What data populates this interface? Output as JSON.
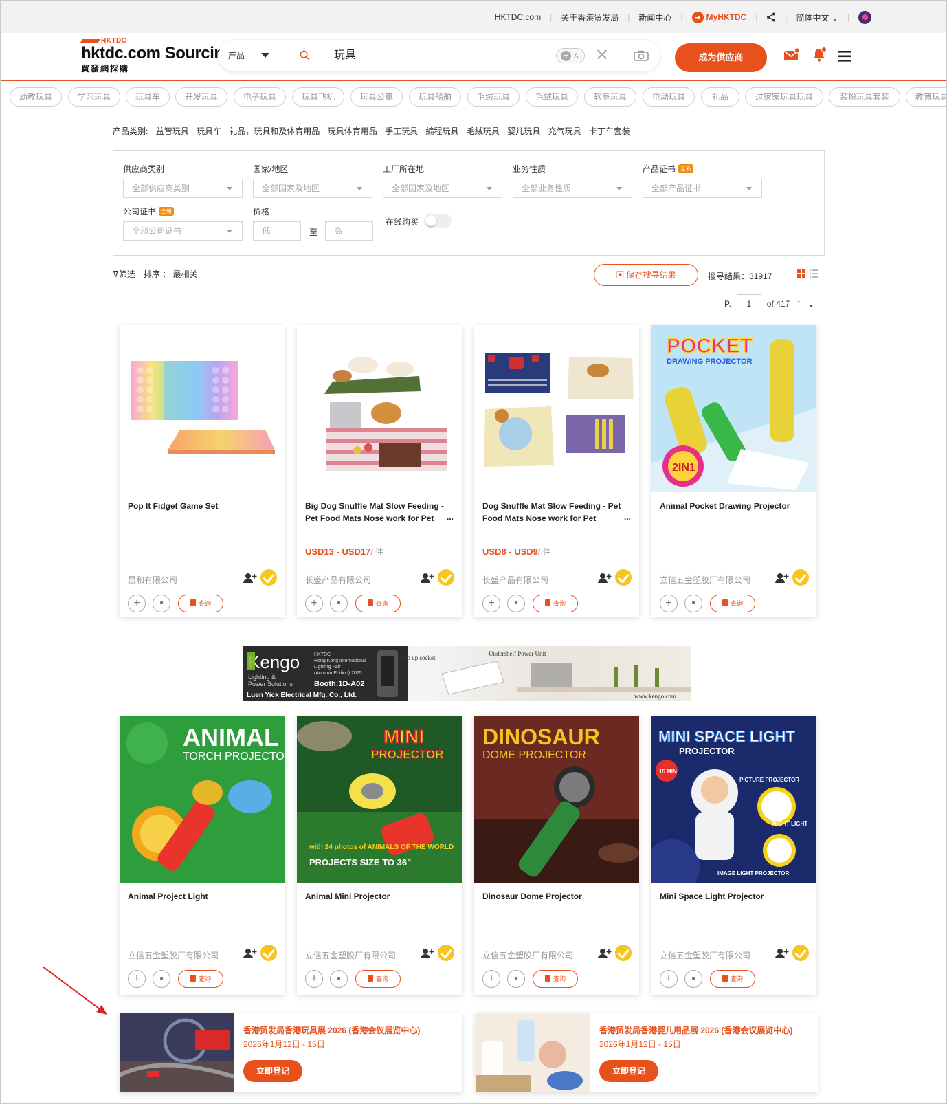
{
  "topbar": {
    "links": [
      "HKTDC.com",
      "关于香港贸发局",
      "新闻中心"
    ],
    "my_hktdc": "MyHKTDC",
    "language": "简体中文"
  },
  "header": {
    "logo_small": "HKTDC",
    "logo_brand": "hktdc.com Sourcing",
    "logo_cn": "貿發網採購",
    "search_category": "产品",
    "search_query": "玩具",
    "ai_label": "AI",
    "supplier_button": "成为供应商"
  },
  "tags": [
    "幼教玩具",
    "学习玩具",
    "玩具车",
    "开发玩具",
    "电子玩具",
    "玩具飞机",
    "玩具公車",
    "玩具船舶",
    "毛绒玩具",
    "毛绒玩具",
    "软身玩具",
    "电动玩具",
    "礼品",
    "过家家玩具玩具",
    "装扮玩具套装",
    "教育玩具"
  ],
  "categories": {
    "label": "产品类别:",
    "links": [
      "益智玩具",
      "玩具车",
      "礼品，玩具和及体育用品",
      "玩具体育用品",
      "手工玩具",
      "編程玩具",
      "毛絨玩具",
      "婴儿玩具",
      "充气玩具",
      "卡丁车套装"
    ]
  },
  "filters": {
    "supplier_type": {
      "label": "供应商类别",
      "value": "全部供应商类别"
    },
    "country": {
      "label": "国家/地区",
      "value": "全部国家及地区"
    },
    "factory": {
      "label": "工厂所在地",
      "value": "全部国家及地区"
    },
    "business": {
      "label": "业务性质",
      "value": "全部业务性质"
    },
    "product_cert": {
      "label": "产品证书",
      "value": "全部产品证书",
      "badge": "全新"
    },
    "company_cert": {
      "label": "公司证书",
      "value": "全部公司证书",
      "badge": "全新"
    },
    "price": {
      "label": "价格",
      "low": "低",
      "to": "至",
      "high": "高"
    },
    "online": {
      "label": "在线购买"
    }
  },
  "sortbar": {
    "filter": "筛选",
    "sort_label": "排序 ：",
    "sort_value": "最相关",
    "save_search": "储存搜寻结果",
    "results_label": "搜寻结果：",
    "results_count": "31917"
  },
  "pager": {
    "prefix": "P.",
    "page": "1",
    "of": "of 417"
  },
  "inquiry_label": "查询",
  "products": [
    {
      "title": "Pop It Fidget Game Set",
      "price": "",
      "unit": "",
      "company": "显和有限公司"
    },
    {
      "title": "Big Dog Snuffle Mat Slow Feeding - Pet Food Mats Nose work for Pet",
      "price": "USD13 - USD17",
      "unit": "/ 件",
      "company": "长盛产品有限公司"
    },
    {
      "title": "Dog Snuffle Mat Slow Feeding - Pet Food Mats Nose work for Pet",
      "price": "USD8 - USD9",
      "unit": "/ 件",
      "company": "长盛产品有限公司"
    },
    {
      "title": "Animal Pocket Drawing Projector",
      "price": "",
      "unit": "",
      "company": "立信五金塑胶厂有限公司"
    },
    {
      "title": "Animal Project Light",
      "price": "",
      "unit": "",
      "company": "立信五金塑胶厂有限公司"
    },
    {
      "title": "Animal Mini Projector",
      "price": "",
      "unit": "",
      "company": "立信五金塑胶厂有限公司"
    },
    {
      "title": "Dinosaur Dome Projector",
      "price": "",
      "unit": "",
      "company": "立信五金塑胶厂有限公司"
    },
    {
      "title": "Mini Space Light Projector",
      "price": "",
      "unit": "",
      "company": "立信五金塑胶厂有限公司"
    }
  ],
  "product_images": {
    "p4": {
      "line1": "POCKET",
      "line2": "DRAWING PROJECTOR",
      "badge": "2IN1"
    },
    "p5": {
      "line1": "ANIMAL",
      "line2": "TORCH PROJECTOR"
    },
    "p6": {
      "line1": "MINI",
      "line2": "PROJECTOR",
      "line3": "with 24 photos of ANIMALS OF THE WORLD",
      "line4": "PROJECTS SIZE TO 36\""
    },
    "p7": {
      "line1": "DINOSAUR",
      "line2": "DOME PROJECTOR"
    },
    "p8": {
      "line1": "MINI SPACE LIGHT",
      "line2": "PROJECTOR",
      "badge": "15 MIN",
      "tag1": "PICTURE PROJECTOR",
      "tag2": "NIGHT LIGHT",
      "tag3": "IMAGE LIGHT PROJECTOR"
    }
  },
  "banner": {
    "brand": "Kengo",
    "sub1": "Lighting &",
    "sub2": "Power Solutions",
    "company": "Luen Yick Electrical Mfg. Co., Ltd.",
    "fair1": "HKTDC",
    "fair2": "Hong Kong International",
    "fair3": "Lighting Fair",
    "fair4": "(Autumn Edition) 2025",
    "booth": "Booth:1D-A02",
    "popup": "Pop up socket",
    "undershelf": "Undershelf Power Unit",
    "url": "www.kengo.com"
  },
  "events": [
    {
      "title": "香港贸发局香港玩具展 2026 (香港会议展览中心)",
      "date": "2026年1月12日 - 15日",
      "button": "立即登记"
    },
    {
      "title": "香港贸发局香港婴儿用品展 2026 (香港会议展览中心)",
      "date": "2026年1月12日 - 15日",
      "button": "立即登记"
    }
  ],
  "colors": {
    "accent": "#e8501c",
    "verified": "#f7c51c"
  }
}
